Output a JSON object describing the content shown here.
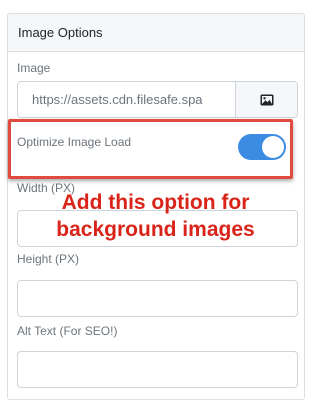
{
  "panel": {
    "title": "Image Options"
  },
  "image": {
    "label": "Image",
    "value": "https://assets.cdn.filesafe.spa",
    "button_icon": "image-icon"
  },
  "optimize": {
    "label": "Optimize Image Load",
    "enabled": true
  },
  "width": {
    "label": "Width (PX)",
    "value": ""
  },
  "height": {
    "label": "Height (PX)",
    "value": ""
  },
  "alt": {
    "label": "Alt Text (For SEO!)",
    "value": ""
  },
  "annotation": {
    "line1": "Add this option for",
    "line2": "background images",
    "color": "#d9241a"
  },
  "colors": {
    "toggle_on": "#3d8ce4",
    "highlight_border": "#e04a3f"
  }
}
